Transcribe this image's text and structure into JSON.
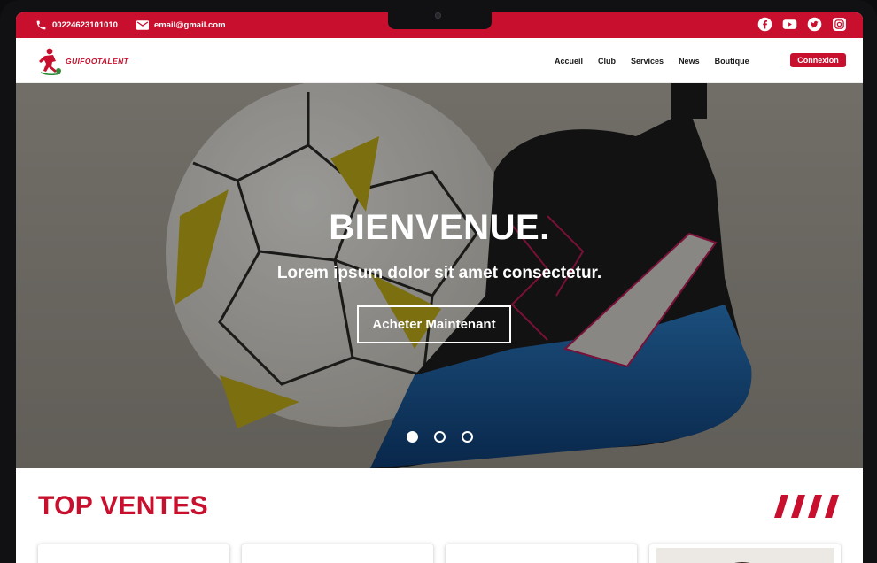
{
  "topbar": {
    "phone": "00224623101010",
    "email": "email@gmail.com",
    "socials": [
      {
        "icon": "facebook-icon"
      },
      {
        "icon": "youtube-icon"
      },
      {
        "icon": "twitter-icon"
      },
      {
        "icon": "instagram-icon"
      }
    ]
  },
  "brand": {
    "name": "GUIFOOTALENT"
  },
  "nav": {
    "items": [
      "Accueil",
      "Club",
      "Services",
      "News",
      "Boutique"
    ],
    "login_label": "Connexion"
  },
  "hero": {
    "title": "BIENVENUE.",
    "subtitle": "Lorem ipsum dolor sit amet consectetur.",
    "cta_label": "Acheter Maintenant",
    "slides": 3,
    "active_slide": 1
  },
  "section": {
    "title": "TOP VENTES"
  },
  "colors": {
    "accent": "#c8102e",
    "overlay": "#000000"
  }
}
